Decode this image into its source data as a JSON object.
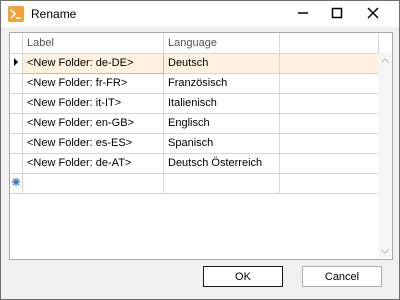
{
  "window": {
    "title": "Rename"
  },
  "grid": {
    "headers": [
      "Label",
      "Language"
    ],
    "rows": [
      {
        "label": "<New Folder: de-DE>",
        "language": "Deutsch"
      },
      {
        "label": "<New Folder: fr-FR>",
        "language": "Französisch"
      },
      {
        "label": "<New Folder: it-IT>",
        "language": "Italienisch"
      },
      {
        "label": "<New Folder: en-GB>",
        "language": "Englisch"
      },
      {
        "label": "<New Folder: es-ES>",
        "language": "Spanisch"
      },
      {
        "label": "<New Folder: de-AT>",
        "language": "Deutsch Österreich"
      }
    ],
    "selected_row": 0
  },
  "buttons": {
    "ok_label": "OK",
    "cancel_label": "Cancel"
  },
  "colors": {
    "app_icon": "#f2a13b",
    "selection": "#fff1dd",
    "new_row_marker": "#2f6fce"
  }
}
